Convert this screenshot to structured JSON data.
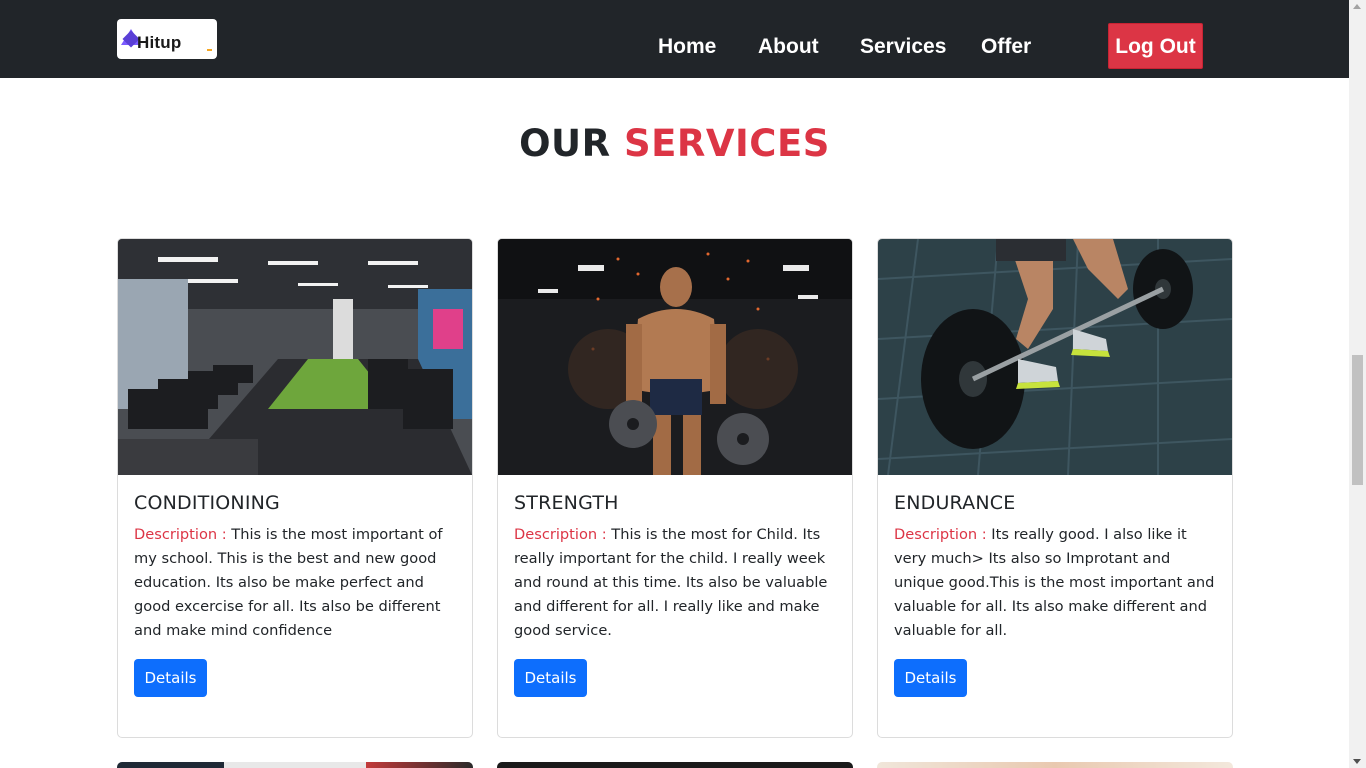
{
  "brand": {
    "logo_text": "Hitup"
  },
  "nav": {
    "items": [
      {
        "label": "Home"
      },
      {
        "label": "About"
      },
      {
        "label": "Services"
      },
      {
        "label": "Offer"
      }
    ],
    "logout_label": "Log Out"
  },
  "section": {
    "title_part1": "OUR",
    "title_part2": "SERVICES"
  },
  "cards": [
    {
      "title": "CONDITIONING",
      "desc_label": "Description :",
      "desc_text": " This is the most important of my school. This is the best and new good education. Its also be make perfect and good excercise for all. Its also be different and make mind confidence",
      "button": "Details",
      "image": "gym-interior-photo"
    },
    {
      "title": "STRENGTH",
      "desc_label": "Description :",
      "desc_text": " This is the most for Child. Its really important for the child. I really week and round at this time. Its also be valuable and different for all. I really like and make good service.",
      "button": "Details",
      "image": "bodybuilder-photo"
    },
    {
      "title": "ENDURANCE",
      "desc_label": "Description :",
      "desc_text": " Its really good. I also like it very much> Its also so Improtant and unique good.This is the most important and valuable for all. Its also make different and valuable for all.",
      "button": "Details",
      "image": "barbell-lift-photo"
    }
  ],
  "colors": {
    "navbar_bg": "#212529",
    "accent_red": "#dc3545",
    "button_blue": "#0d6efd"
  }
}
